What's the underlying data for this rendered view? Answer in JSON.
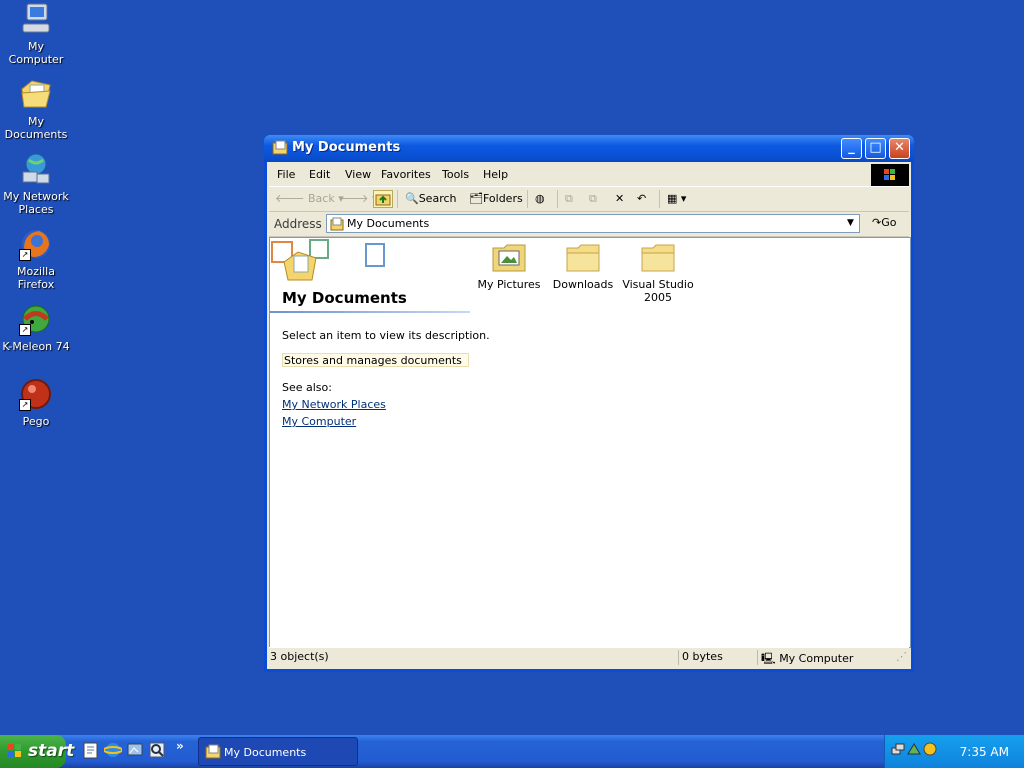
{
  "desktop": {
    "icons": [
      {
        "label": "My Computer",
        "icon": "my-computer-icon"
      },
      {
        "label": "My Documents",
        "icon": "my-documents-icon"
      },
      {
        "label_line1": "My Network",
        "label_line2": "Places",
        "icon": "network-places-icon"
      },
      {
        "label": "Mozilla Firefox",
        "icon": "firefox-icon"
      },
      {
        "label": "K-Meleon 74",
        "icon": "k-meleon-icon"
      },
      {
        "label": "Pego",
        "icon": "pego-icon"
      }
    ]
  },
  "window": {
    "title": "My Documents",
    "menu": [
      "File",
      "Edit",
      "View",
      "Favorites",
      "Tools",
      "Help"
    ],
    "toolbar": {
      "back": "Back",
      "search": "Search",
      "folders": "Folders"
    },
    "address": {
      "label": "Address",
      "value": "My Documents",
      "go": "Go"
    },
    "panel": {
      "title": "My Documents",
      "description": "Select an item to view its description.",
      "info": "Stores and manages documents",
      "see_also": "See also:",
      "links": [
        "My Network Places",
        "My Computer"
      ]
    },
    "items": [
      {
        "label": "My Pictures",
        "icon": "my-pictures-folder-icon"
      },
      {
        "label": "Downloads",
        "icon": "folder-icon"
      },
      {
        "label_line1": "Visual Studio",
        "label_line2": "2005",
        "icon": "folder-icon"
      }
    ],
    "status": {
      "objects": "3 object(s)",
      "size": "0 bytes",
      "zone": "My Computer"
    }
  },
  "taskbar": {
    "start": "start",
    "task": "My Documents",
    "clock": "7:35 AM"
  },
  "colors": {
    "desktop": "#1f4fb8",
    "titlebar": "#0a4fd0",
    "start_green": "#2f9a2f",
    "tray": "#0f82dc"
  }
}
